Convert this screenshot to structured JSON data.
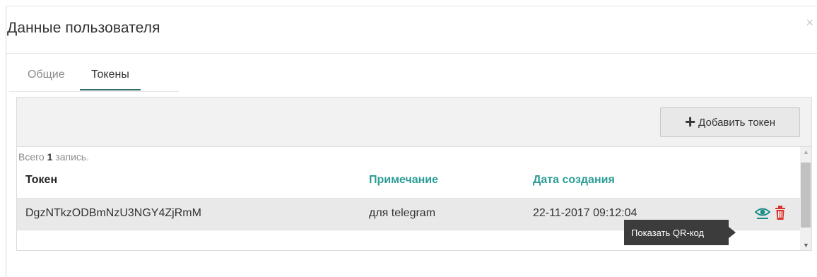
{
  "modal": {
    "title": "Данные пользователя",
    "close_label": "×"
  },
  "tabs": [
    {
      "label": "Общие",
      "active": false
    },
    {
      "label": "Токены",
      "active": true
    }
  ],
  "toolbar": {
    "add_label": "Добавить токен",
    "add_icon": "plus-icon"
  },
  "grid": {
    "total_prefix": "Всего",
    "total_count": "1",
    "total_suffix": "запись.",
    "columns": [
      "Токен",
      "Примечание",
      "Дата создания"
    ],
    "rows": [
      {
        "token": "DgzNTkzODBmNzU3NGY4ZjRmM",
        "note": "для telegram",
        "created": "22-11-2017 09:12:04"
      }
    ],
    "row_actions": [
      "eye-icon",
      "trash-icon"
    ]
  },
  "tooltip": "Показать QR-код",
  "colors": {
    "accent": "#2a9d96",
    "danger": "#d9342b",
    "tab_active": "#2f6b6b",
    "tooltip_bg": "#3c3c3c"
  }
}
